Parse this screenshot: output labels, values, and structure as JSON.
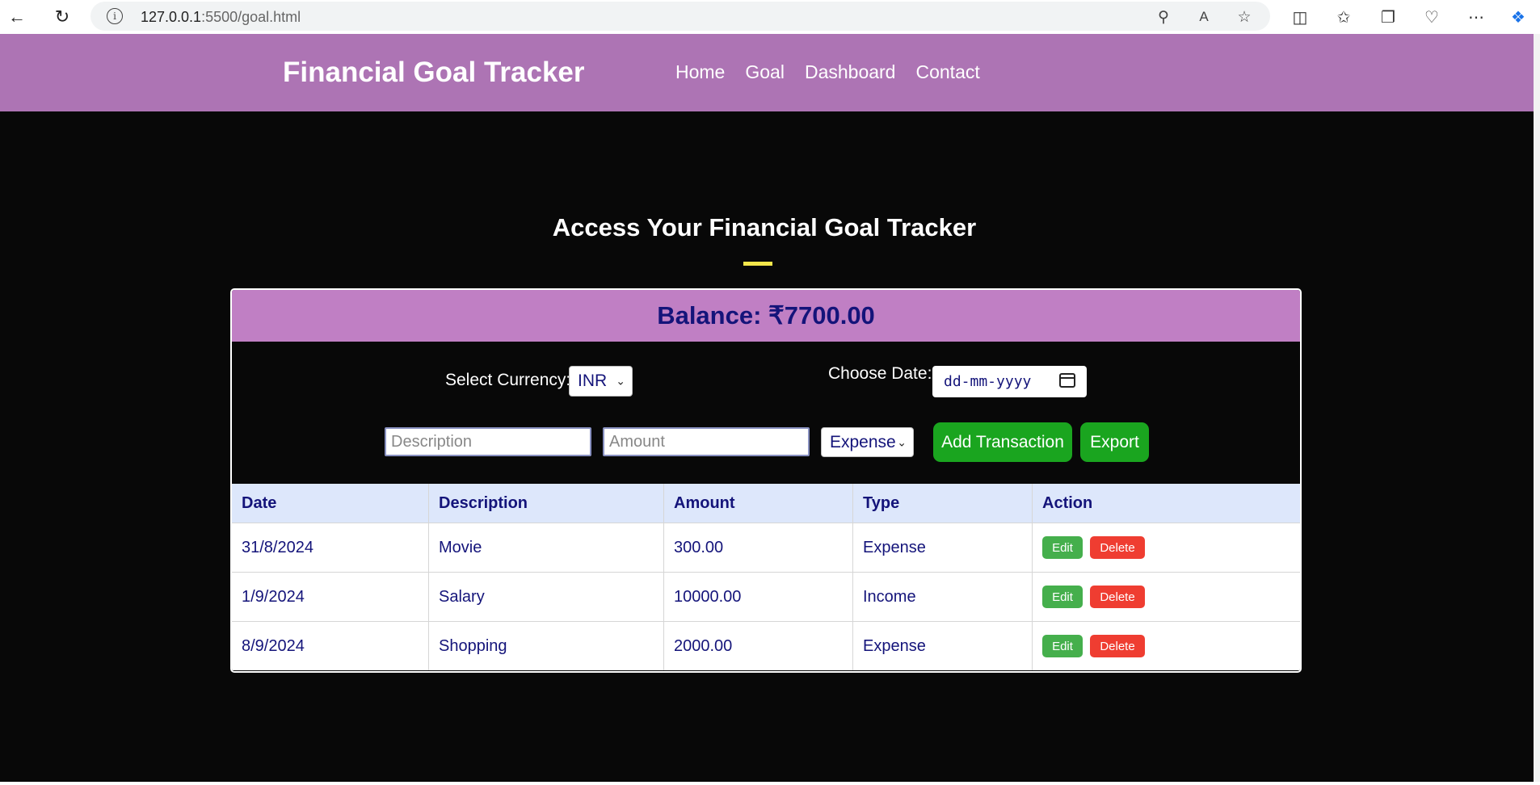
{
  "browser": {
    "url_host": "127.0.0.1",
    "url_rest": ":5500/goal.html"
  },
  "navbar": {
    "brand": "Financial Goal Tracker",
    "links": [
      "Home",
      "Goal",
      "Dashboard",
      "Contact"
    ]
  },
  "main": {
    "heading": "Access Your Financial Goal Tracker",
    "accent_color": "#f4e74b"
  },
  "tracker": {
    "balance": "Balance: ₹7700.00",
    "currency_label": "Select Currency:",
    "currency_value": "INR",
    "date_label": "Choose Date:",
    "date_placeholder": "dd-mm-yyyy",
    "description_placeholder": "Description",
    "amount_placeholder": "Amount",
    "type_value": "Expense",
    "add_button": "Add Transaction",
    "export_button": "Export"
  },
  "table": {
    "columns": [
      "Date",
      "Description",
      "Amount",
      "Type",
      "Action"
    ],
    "rows": [
      {
        "date": "31/8/2024",
        "description": "Movie",
        "amount": "300.00",
        "type": "Expense",
        "edit": "Edit",
        "delete": "Delete"
      },
      {
        "date": "1/9/2024",
        "description": "Salary",
        "amount": "10000.00",
        "type": "Income",
        "edit": "Edit",
        "delete": "Delete"
      },
      {
        "date": "8/9/2024",
        "description": "Shopping",
        "amount": "2000.00",
        "type": "Expense",
        "edit": "Edit",
        "delete": "Delete"
      }
    ]
  },
  "colors": {
    "navbar": "#ad74b4",
    "balance_bar": "#c07fc4",
    "primary_text": "#14147a",
    "green_button": "#1aa51f",
    "delete_button": "#ef3d31"
  }
}
